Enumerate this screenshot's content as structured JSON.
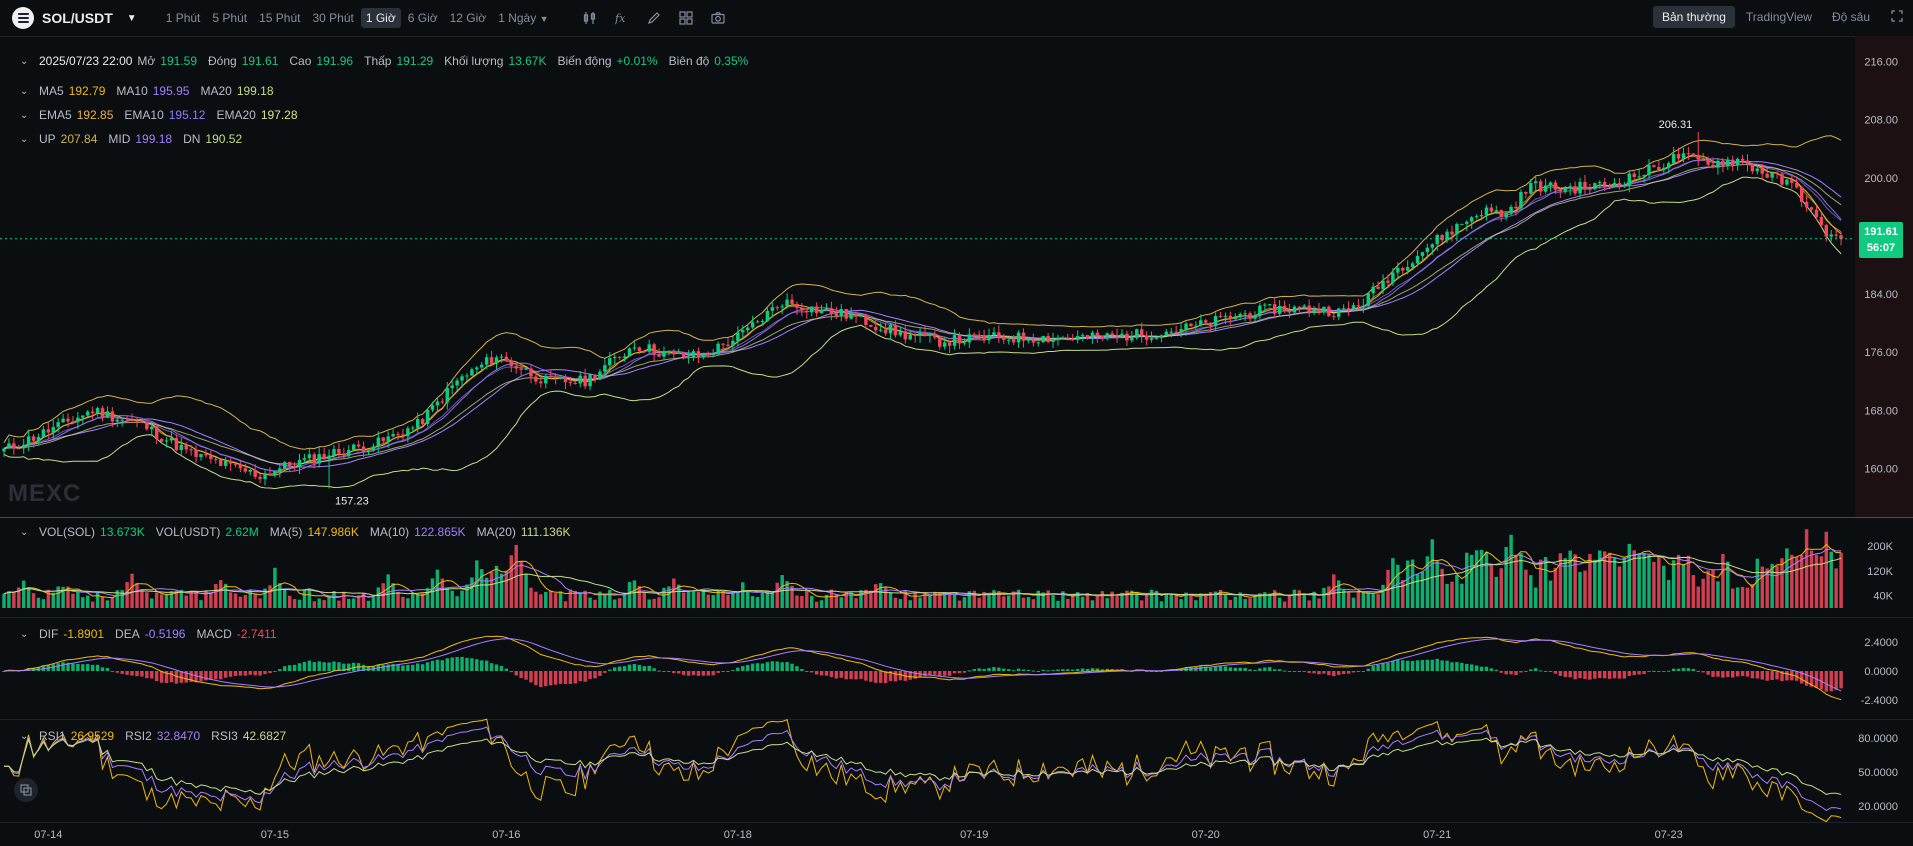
{
  "toolbar": {
    "symbol": "SOL/USDT",
    "intervals": [
      "1 Phút",
      "5 Phút",
      "15 Phút",
      "30 Phút",
      "1 Giờ",
      "6 Giờ",
      "12 Giờ",
      "1 Ngày"
    ],
    "active_interval": "1 Giờ",
    "view_modes": [
      "Bản thường",
      "TradingView",
      "Độ sâu"
    ],
    "active_view": "Bản thường"
  },
  "legend": {
    "ohlc": {
      "date": "2025/07/23 22:00",
      "open_label": "Mở",
      "open": "191.59",
      "close_label": "Đóng",
      "close": "191.61",
      "high_label": "Cao",
      "high": "191.96",
      "low_label": "Thấp",
      "low": "191.29",
      "volume_label": "Khối lượng",
      "volume": "13.67K",
      "change_label": "Biến động",
      "change": "+0.01%",
      "amplitude_label": "Biên độ",
      "amplitude": "0.35%"
    },
    "ma": {
      "ma5_label": "MA5",
      "ma5": "192.79",
      "ma10_label": "MA10",
      "ma10": "195.95",
      "ma20_label": "MA20",
      "ma20": "199.18"
    },
    "ema": {
      "ema5_label": "EMA5",
      "ema5": "192.85",
      "ema10_label": "EMA10",
      "ema10": "195.12",
      "ema20_label": "EMA20",
      "ema20": "197.28"
    },
    "boll": {
      "up_label": "UP",
      "up": "207.84",
      "mid_label": "MID",
      "mid": "199.18",
      "dn_label": "DN",
      "dn": "190.52"
    },
    "vol": {
      "vol_sol_label": "VOL(SOL)",
      "vol_sol": "13.673K",
      "vol_usdt_label": "VOL(USDT)",
      "vol_usdt": "2.62M",
      "ma5_label": "MA(5)",
      "ma5": "147.986K",
      "ma10_label": "MA(10)",
      "ma10": "122.865K",
      "ma20_label": "MA(20)",
      "ma20": "111.136K"
    },
    "macd": {
      "dif_label": "DIF",
      "dif": "-1.8901",
      "dea_label": "DEA",
      "dea": "-0.5196",
      "macd_label": "MACD",
      "macd": "-2.7411"
    },
    "rsi": {
      "rsi1_label": "RSI1",
      "rsi1": "26.9529",
      "rsi2_label": "RSI2",
      "rsi2": "32.8470",
      "rsi3_label": "RSI3",
      "rsi3": "42.6827"
    }
  },
  "watermark": "MEXC",
  "price_tag": {
    "price": "191.61",
    "countdown": "56:07"
  },
  "colors": {
    "up": "#0ecb81",
    "down": "#f6465d",
    "ma5": "#f0b90b",
    "ma10": "#a57eff",
    "ma20": "#c7dc84",
    "ema5": "#e8b24a",
    "ema10": "#8f7bff",
    "ema20": "#d6e58a",
    "boll_up": "#d5b04d",
    "boll_mid": "#a57eff",
    "boll_dn": "#c7dc84",
    "background": "#0b0e11"
  },
  "chart_data": {
    "type": "candlestick",
    "x_tick_labels": [
      "07-14",
      "07-15",
      "07-16",
      "07-18",
      "07-19",
      "07-20",
      "07-21",
      "07-23"
    ],
    "price_axis": {
      "ticks": [
        "216.00",
        "208.00",
        "200.00",
        "184.00",
        "176.00",
        "168.00",
        "160.00"
      ],
      "range": [
        154,
        216.5
      ]
    },
    "annotations": {
      "high": "206.31",
      "low": "157.23"
    },
    "close_key_points": [
      [
        0,
        162.5
      ],
      [
        10,
        165.5
      ],
      [
        18,
        168
      ],
      [
        28,
        166
      ],
      [
        38,
        162
      ],
      [
        47,
        160
      ],
      [
        52,
        159
      ],
      [
        58,
        160.5
      ],
      [
        66,
        162
      ],
      [
        76,
        163.5
      ],
      [
        84,
        166
      ],
      [
        92,
        172
      ],
      [
        100,
        175.5
      ],
      [
        110,
        172
      ],
      [
        118,
        172
      ],
      [
        128,
        177
      ],
      [
        136,
        175.5
      ],
      [
        142,
        175.5
      ],
      [
        150,
        178.5
      ],
      [
        158,
        183
      ],
      [
        164,
        182
      ],
      [
        172,
        181
      ],
      [
        182,
        178.5
      ],
      [
        190,
        177.5
      ],
      [
        200,
        178
      ],
      [
        212,
        178
      ],
      [
        222,
        178
      ],
      [
        232,
        178.5
      ],
      [
        242,
        179.5
      ],
      [
        250,
        181
      ],
      [
        258,
        182
      ],
      [
        266,
        182
      ],
      [
        272,
        181.5
      ],
      [
        276,
        183
      ],
      [
        282,
        187
      ],
      [
        290,
        191
      ],
      [
        300,
        195.5
      ],
      [
        305,
        195
      ],
      [
        310,
        199
      ],
      [
        316,
        198.5
      ],
      [
        326,
        199
      ],
      [
        334,
        201
      ],
      [
        340,
        203
      ],
      [
        346,
        202
      ],
      [
        352,
        202.5
      ],
      [
        358,
        200.5
      ],
      [
        364,
        198.5
      ],
      [
        369,
        193
      ],
      [
        372,
        191.61
      ]
    ],
    "low_point": {
      "i": 66,
      "value": 157.23
    },
    "high_point": {
      "i": 344,
      "value": 206.31
    },
    "volume_axis": {
      "ticks": [
        "200K",
        "120K",
        "40K"
      ],
      "max": 290
    },
    "volume_spikes_k": [
      [
        4,
        120
      ],
      [
        12,
        90
      ],
      [
        26,
        120
      ],
      [
        44,
        100
      ],
      [
        55,
        130
      ],
      [
        78,
        130
      ],
      [
        88,
        130
      ],
      [
        96,
        180
      ],
      [
        100,
        190
      ],
      [
        104,
        240
      ],
      [
        128,
        110
      ],
      [
        136,
        120
      ],
      [
        150,
        90
      ],
      [
        158,
        130
      ],
      [
        178,
        110
      ],
      [
        206,
        60
      ],
      [
        250,
        40
      ],
      [
        270,
        120
      ],
      [
        282,
        180
      ],
      [
        290,
        230
      ],
      [
        300,
        260
      ],
      [
        306,
        290
      ],
      [
        318,
        230
      ],
      [
        324,
        260
      ],
      [
        330,
        250
      ],
      [
        340,
        230
      ],
      [
        362,
        200
      ],
      [
        366,
        270
      ],
      [
        370,
        270
      ]
    ],
    "macd_axis": {
      "ticks": [
        "2.4000",
        "0.0000",
        "-2.4000"
      ],
      "range": [
        -3.8,
        3.5
      ]
    },
    "rsi_axis": {
      "ticks": [
        "80.0000",
        "50.0000",
        "20.0000"
      ],
      "range": [
        5,
        95
      ]
    },
    "grid": false
  }
}
